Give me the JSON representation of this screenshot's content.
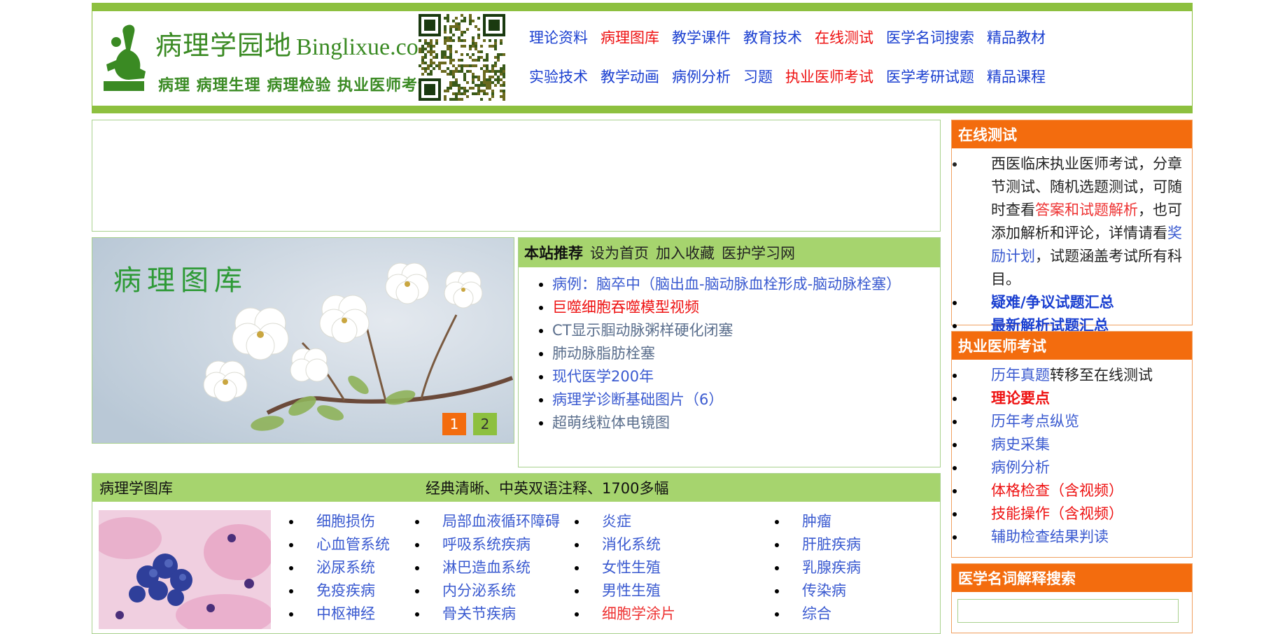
{
  "header": {
    "logo_title": "病理学园地",
    "logo_url": "Binglixue.com",
    "logo_subtitle": "病理 病理生理 病理检验 执业医师考试",
    "nav_row1": [
      {
        "label": "理论资料",
        "color": "blue"
      },
      {
        "label": "病理图库",
        "color": "red"
      },
      {
        "label": "教学课件",
        "color": "blue"
      },
      {
        "label": "教育技术",
        "color": "blue"
      },
      {
        "label": "在线测试",
        "color": "red"
      },
      {
        "label": "医学名词搜索",
        "color": "blue"
      },
      {
        "label": "精品教材",
        "color": "blue"
      }
    ],
    "nav_row2": [
      {
        "label": "实验技术",
        "color": "blue"
      },
      {
        "label": "教学动画",
        "color": "blue"
      },
      {
        "label": "病例分析",
        "color": "blue"
      },
      {
        "label": "习题",
        "color": "blue"
      },
      {
        "label": "执业医师考试",
        "color": "red"
      },
      {
        "label": "医学考研试题",
        "color": "blue"
      },
      {
        "label": "精品课程",
        "color": "blue"
      }
    ]
  },
  "slideshow": {
    "title": "病理图库",
    "dots": [
      "1",
      "2"
    ],
    "active_index": 0
  },
  "recommend": {
    "title": "本站推荐",
    "links": [
      "设为首页",
      "加入收藏",
      "医护学习网"
    ],
    "items": [
      {
        "text": "病例：脑卒中（脑出血-脑动脉血栓形成-脑动脉栓塞）",
        "color": "linkblue"
      },
      {
        "text": "巨噬细胞吞噬模型视频",
        "color": "red"
      },
      {
        "text": "CT显示腘动脉粥样硬化闭塞",
        "color": "muted"
      },
      {
        "text": "肺动脉脂肪栓塞",
        "color": "muted"
      },
      {
        "text": "现代医学200年",
        "color": "linkblue"
      },
      {
        "text": "病理学诊断基础图片（6）",
        "color": "linkblue"
      },
      {
        "text": "超萌线粒体电镜图",
        "color": "muted"
      }
    ]
  },
  "gallery": {
    "title": "病理学图库",
    "description": "经典清晰、中英双语注释、1700多幅",
    "columns": [
      [
        "细胞损伤",
        "心血管系统",
        "泌尿系统",
        "免疫疾病",
        "中枢神经"
      ],
      [
        "局部血液循环障碍",
        "呼吸系统疾病",
        "淋巴造血系统",
        "内分泌系统",
        "骨关节疾病"
      ],
      [
        "炎症",
        "消化系统",
        "女性生殖",
        "男性生殖",
        "细胞学涂片"
      ],
      [
        "肿瘤",
        "肝脏疾病",
        "乳腺疾病",
        "传染病",
        "综合"
      ]
    ],
    "red_items": [
      "细胞学涂片"
    ]
  },
  "online_test": {
    "title": "在线测试",
    "intro_before": "西医临床执业医师考试，分章节测试、随机选题测试，可随时查看",
    "intro_link1": "答案和试题解析",
    "intro_middle": "，也可添加解析和评论，详情请看",
    "intro_link2": "奖励计划",
    "intro_after": "，试题涵盖考试所有科目。",
    "items": [
      "疑难/争议试题汇总",
      "最新解析试题汇总"
    ]
  },
  "exam": {
    "title": "执业医师考试",
    "item1_link": "历年真题",
    "item1_rest": "转移至在线测试",
    "items": [
      {
        "text": "理论要点",
        "color": "red",
        "bold": true
      },
      {
        "text": "历年考点纵览",
        "color": "linkblue",
        "bold": false
      },
      {
        "text": "病史采集",
        "color": "linkblue",
        "bold": false
      },
      {
        "text": "病例分析",
        "color": "linkblue",
        "bold": false
      },
      {
        "text": "体格检查（含视频）",
        "color": "red",
        "bold": false
      },
      {
        "text": "技能操作（含视频）",
        "color": "red",
        "bold": false
      },
      {
        "text": "辅助检查结果判读",
        "color": "linkblue",
        "bold": false
      }
    ]
  },
  "term_search": {
    "title": "医学名词解释搜索"
  },
  "colors": {
    "green_bar": "#8dc03f",
    "green_head": "#a6d46e",
    "orange_head": "#f36c0e",
    "nav_blue": "#1a3fd0",
    "nav_red": "#ee1111"
  }
}
